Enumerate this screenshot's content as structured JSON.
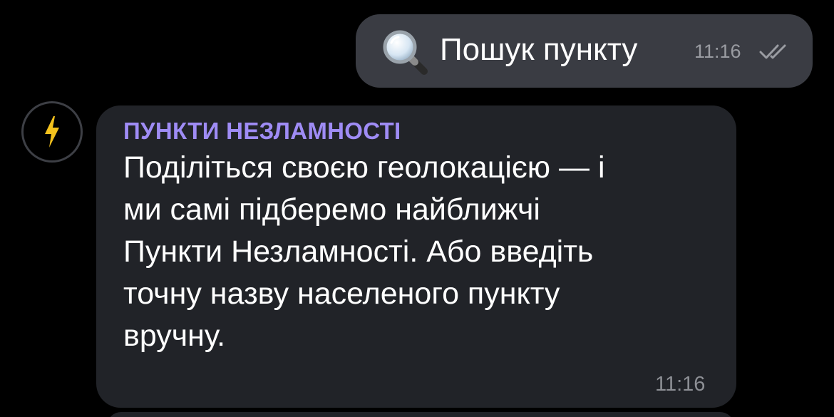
{
  "outgoing": {
    "icon": "magnifying-glass-emoji",
    "text": "Пошук пункту",
    "time": "11:16",
    "status_icon": "double-check-icon"
  },
  "incoming": {
    "avatar_icon": "lightning-bolt-icon",
    "sender": "ПУНКТИ НЕЗЛАМНОСТІ",
    "lines": [
      "Поділіться своєю геолокацією — і",
      "ми самі підберемо найближчі",
      "Пункти Незламності. Або введіть",
      "точну назву населеного пункту",
      "вручну."
    ],
    "time": "11:16"
  },
  "colors": {
    "background": "#000000",
    "outgoing_bubble": "#3a3c43",
    "incoming_bubble": "#212328",
    "sender_name": "#9f8cf5",
    "bolt": "#f4c21d"
  }
}
